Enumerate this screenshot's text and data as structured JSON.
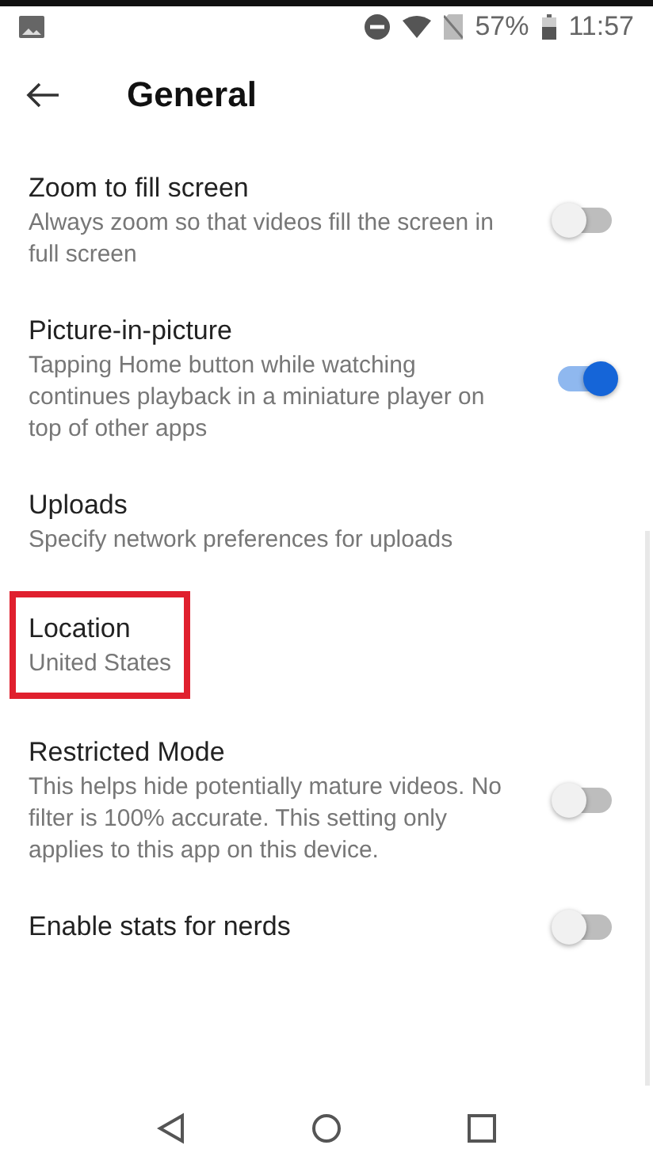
{
  "status_bar": {
    "battery": "57%",
    "time": "11:57"
  },
  "header": {
    "title": "General"
  },
  "settings": [
    {
      "title": "Zoom to fill screen",
      "description": "Always zoom so that videos fill the screen in full screen",
      "kind": "toggle",
      "on": false,
      "highlighted": false
    },
    {
      "title": "Picture-in-picture",
      "description": "Tapping Home button while watching continues playback in a miniature player on top of other apps",
      "kind": "toggle",
      "on": true,
      "highlighted": false
    },
    {
      "title": "Uploads",
      "description": "Specify network preferences for uploads",
      "kind": "link",
      "highlighted": false
    },
    {
      "title": "Location",
      "description": "United States",
      "kind": "link",
      "highlighted": true
    },
    {
      "title": "Restricted Mode",
      "description": "This helps hide potentially mature videos. No filter is 100% accurate. This setting only applies to this app on this device.",
      "kind": "toggle",
      "on": false,
      "highlighted": false
    },
    {
      "title": "Enable stats for nerds",
      "kind": "toggle",
      "on": false,
      "highlighted": false
    }
  ]
}
